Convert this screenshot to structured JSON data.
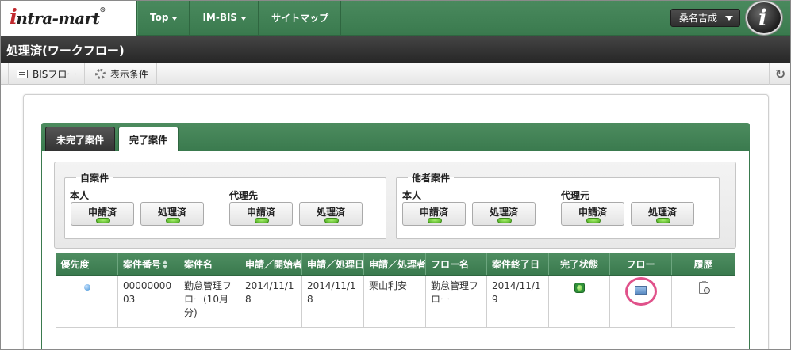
{
  "header": {
    "logo": "intra-mart",
    "nav": [
      {
        "label": "Top",
        "dropdown": true
      },
      {
        "label": "IM-BIS",
        "dropdown": true
      },
      {
        "label": "サイトマップ",
        "dropdown": false
      }
    ],
    "user_name": "桑名吉成"
  },
  "page": {
    "title": "処理済(ワークフロー)"
  },
  "toolbar": {
    "bis_flow": "BISフロー",
    "display_conditions": "表示条件"
  },
  "tabs": [
    {
      "label": "未完了案件",
      "active": false
    },
    {
      "label": "完了案件",
      "active": true
    }
  ],
  "filters": {
    "own": {
      "legend": "自案件",
      "groups": [
        {
          "label": "本人",
          "buttons": [
            "申請済",
            "処理済"
          ]
        },
        {
          "label": "代理先",
          "buttons": [
            "申請済",
            "処理済"
          ]
        }
      ]
    },
    "others": {
      "legend": "他者案件",
      "groups": [
        {
          "label": "本人",
          "buttons": [
            "申請済",
            "処理済"
          ]
        },
        {
          "label": "代理元",
          "buttons": [
            "申請済",
            "処理済"
          ]
        }
      ]
    }
  },
  "table": {
    "columns": [
      "優先度",
      "案件番号",
      "案件名",
      "申請／開始者",
      "申請／処理日",
      "申請／処理者",
      "フロー名",
      "案件終了日",
      "完了状態",
      "フロー",
      "履歴"
    ],
    "rows": [
      {
        "case_number": "0000000003",
        "case_name": "勤怠管理フロー(10月分)",
        "applicant": "2014/11/18",
        "process_date": "2014/11/18",
        "processor": "栗山利安",
        "flow_name": "勤怠管理フロー",
        "end_date": "2014/11/19"
      }
    ]
  },
  "colors": {
    "header_green": "#3a7a4e",
    "title_dark": "#262626",
    "highlight_circle": "#e0518a"
  },
  "icons": [
    "chevron-down-icon",
    "list-icon",
    "gear-icon",
    "refresh-icon",
    "sort-icon",
    "priority-dot-icon",
    "complete-status-icon",
    "flow-image-icon",
    "history-icon"
  ]
}
